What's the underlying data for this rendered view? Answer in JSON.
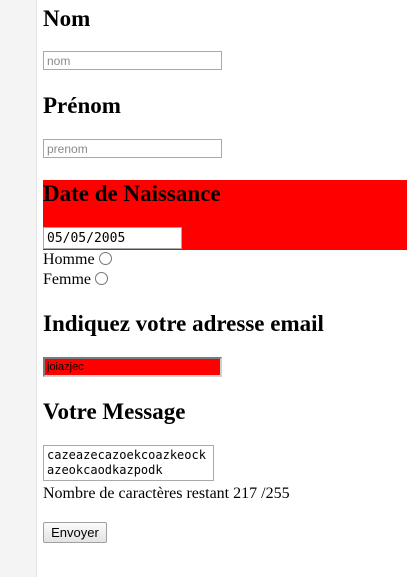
{
  "form": {
    "nom": {
      "label": "Nom",
      "placeholder": "nom",
      "value": ""
    },
    "prenom": {
      "label": "Prénom",
      "placeholder": "prenom",
      "value": ""
    },
    "birthdate": {
      "label": "Date de Naissance",
      "value": "05/05/2005"
    },
    "gender": {
      "options": [
        {
          "label": "Homme",
          "checked": false
        },
        {
          "label": "Femme",
          "checked": false
        }
      ]
    },
    "email": {
      "label": "Indiquez votre adresse email",
      "value": "joiazjec"
    },
    "message": {
      "label": "Votre Message",
      "value": "cazeazecazoekcoazkeockazeokcaodkazpodk",
      "counter_text": "Nombre de caractères restant 217 /255"
    },
    "submit_label": "Envoyer"
  },
  "colors": {
    "invalid_highlight": "#ff0000"
  }
}
